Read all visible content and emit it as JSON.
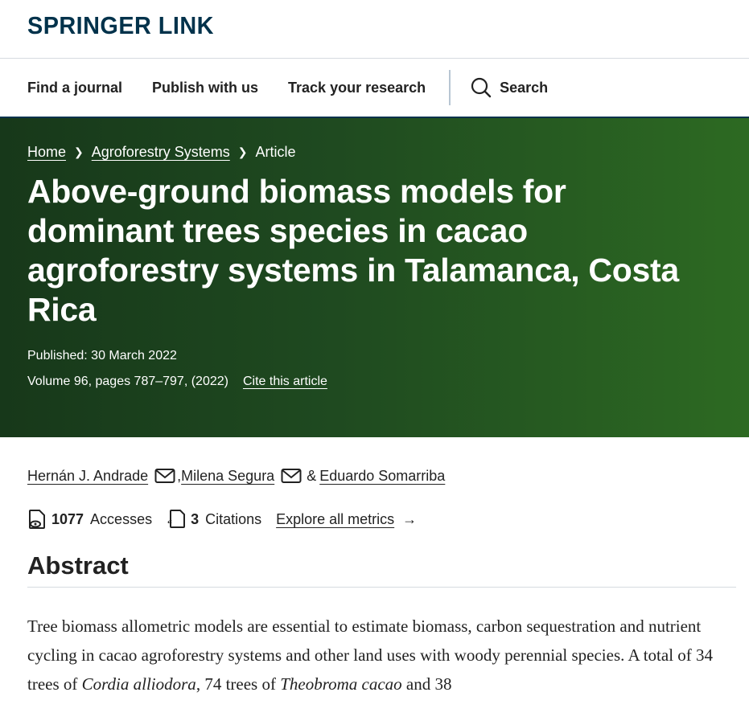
{
  "logo": {
    "text": "SPRINGER LINK"
  },
  "nav": {
    "items": [
      "Find a journal",
      "Publish with us",
      "Track your research"
    ],
    "search_label": "Search"
  },
  "breadcrumb": {
    "home": "Home",
    "journal": "Agroforestry Systems",
    "current": "Article"
  },
  "article": {
    "title": "Above-ground biomass models for dominant trees species in cacao agroforestry systems in Talamanca, Costa Rica",
    "published": "Published: 30 March 2022",
    "volume": "Volume 96, pages 787–797, (2022)",
    "cite_label": "Cite this article"
  },
  "authors": {
    "a1": "Hernán J. Andrade",
    "a2": "Milena Segura",
    "a3": "Eduardo Somarriba",
    "comma": ",",
    "amp": "&"
  },
  "metrics": {
    "accesses_count": "1077",
    "accesses_label": "Accesses",
    "citations_count": "3",
    "citations_label": "Citations",
    "explore_label": "Explore all metrics",
    "arrow": "→"
  },
  "abstract": {
    "heading": "Abstract",
    "p1": "Tree biomass allometric models are essential to estimate biomass, carbon sequestration and nutrient cycling in cacao agroforestry systems and other land uses with woody perennial species. A total of 34 trees of ",
    "sp1": "Cordia alliodora",
    "p2": ", 74 trees of ",
    "sp2": "Theobroma cacao",
    "p3": " and 38"
  },
  "colors": {
    "brand": "#01324b",
    "hero_start": "#17381a",
    "hero_end": "#2d6a22"
  }
}
